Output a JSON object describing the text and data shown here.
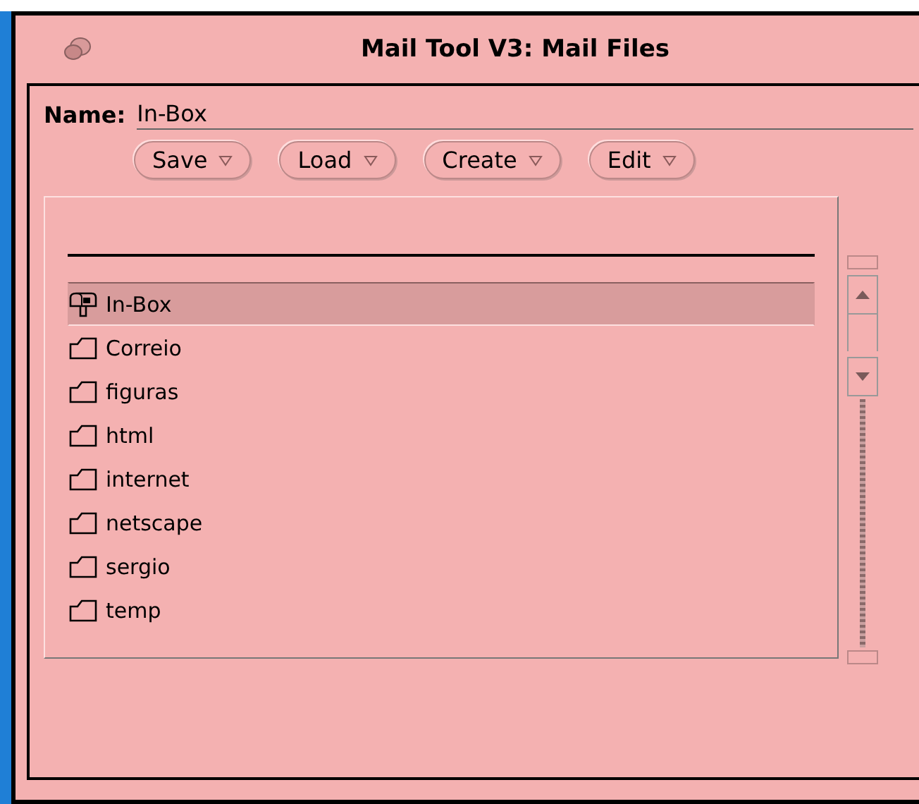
{
  "window": {
    "title": "Mail Tool V3: Mail Files"
  },
  "name_field": {
    "label": "Name:",
    "value": "In-Box"
  },
  "buttons": [
    "Save",
    "Load",
    "Create",
    "Edit"
  ],
  "files": [
    {
      "name": "In-Box",
      "kind": "mailbox",
      "selected": true
    },
    {
      "name": "Correio",
      "kind": "folder",
      "selected": false
    },
    {
      "name": "figuras",
      "kind": "folder",
      "selected": false
    },
    {
      "name": "html",
      "kind": "folder",
      "selected": false
    },
    {
      "name": "internet",
      "kind": "folder",
      "selected": false
    },
    {
      "name": "netscape",
      "kind": "folder",
      "selected": false
    },
    {
      "name": "sergio",
      "kind": "folder",
      "selected": false
    },
    {
      "name": "temp",
      "kind": "folder",
      "selected": false
    }
  ]
}
